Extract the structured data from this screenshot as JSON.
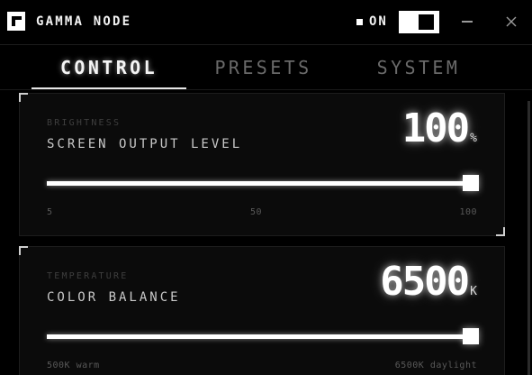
{
  "app": {
    "title": "GAMMA NODE",
    "power_label": "ON",
    "power_on": true
  },
  "tabs": [
    {
      "label": "CONTROL",
      "active": true
    },
    {
      "label": "PRESETS",
      "active": false
    },
    {
      "label": "SYSTEM",
      "active": false
    }
  ],
  "brightness": {
    "eyebrow": "BRIGHTNESS",
    "title": "SCREEN OUTPUT LEVEL",
    "value": "100",
    "unit": "%",
    "min": 5,
    "max": 100,
    "level": 100,
    "tick_min": "5",
    "tick_mid": "50",
    "tick_max": "100"
  },
  "temperature": {
    "eyebrow": "TEMPERATURE",
    "title": "COLOR BALANCE",
    "value": "6500",
    "unit": "K",
    "min": 500,
    "max": 6500,
    "level": 6500,
    "tick_min": "500K warm",
    "tick_max": "6500K daylight"
  },
  "icons": {
    "logo": "gamma-node-logo-icon",
    "power": "power-indicator-icon",
    "minimize": "minimize-icon",
    "close": "close-icon"
  },
  "colors": {
    "background": "#000000",
    "panel": "#0b0b0b",
    "accent": "#ffffff",
    "inactive_tab": "#6a6a6a"
  }
}
